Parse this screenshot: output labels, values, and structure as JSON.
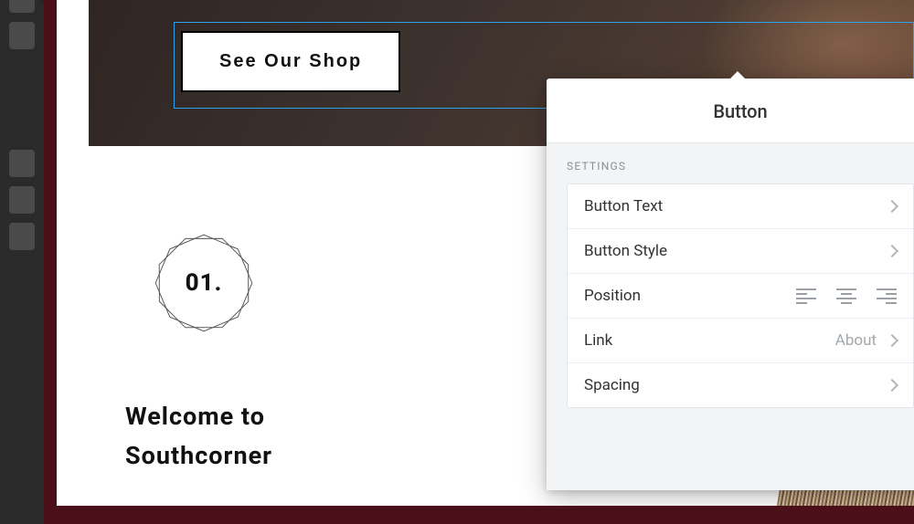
{
  "hero": {
    "cta_label": "See Our Shop"
  },
  "badge": {
    "number": "01."
  },
  "welcome": {
    "line1": "Welcome to",
    "line2": "Southcorner"
  },
  "popover": {
    "title": "Button",
    "section_label": "SETTINGS",
    "rows": {
      "button_text": "Button Text",
      "button_style": "Button Style",
      "position": "Position",
      "link": "Link",
      "link_value": "About",
      "spacing": "Spacing"
    }
  }
}
